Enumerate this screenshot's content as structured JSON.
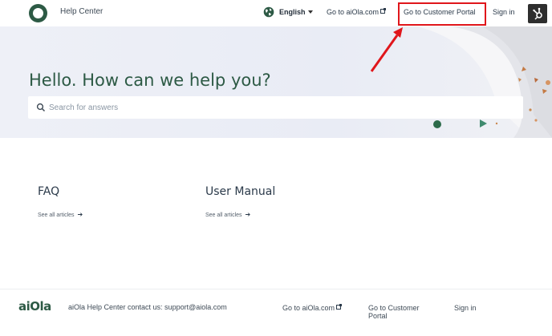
{
  "header": {
    "title": "Help Center",
    "language": "English",
    "link_aiola": "Go to aiOla.com",
    "link_portal": "Go to Customer Portal",
    "sign_in": "Sign in"
  },
  "hero": {
    "heading": "Hello. How can we help you?",
    "search_placeholder": "Search for answers"
  },
  "categories": [
    {
      "title": "FAQ",
      "link": "See all articles"
    },
    {
      "title": "User Manual",
      "link": "See all articles"
    }
  ],
  "footer": {
    "logo": "aiOla",
    "contact": "aiOla Help Center contact us: support@aiola.com",
    "link_aiola": "Go to aiOla.com",
    "link_portal": "Go to Customer Portal",
    "sign_in": "Sign in"
  },
  "colors": {
    "brand_green": "#2d5a45",
    "highlight_red": "#e0161b"
  }
}
